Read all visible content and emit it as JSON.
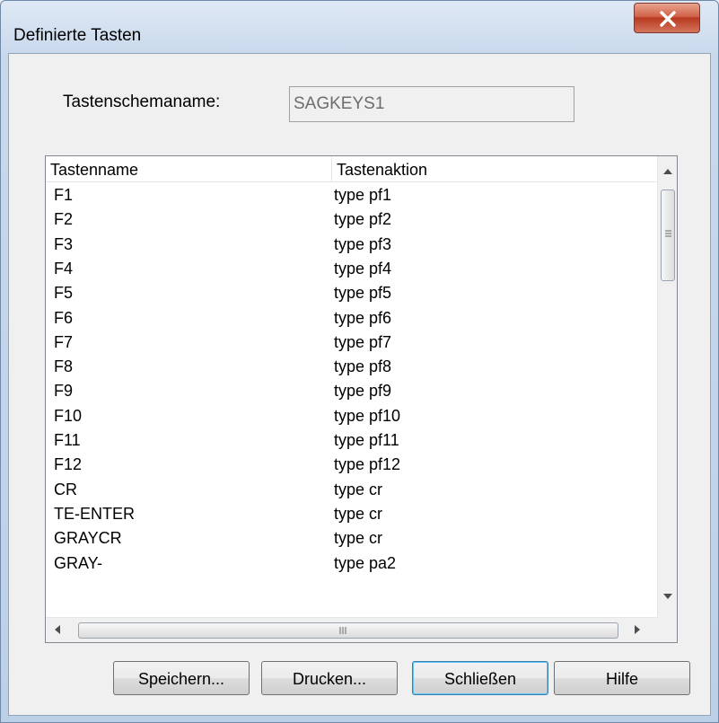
{
  "window": {
    "title": "Definierte Tasten",
    "close_icon": "close-x-icon"
  },
  "scheme": {
    "label": "Tastenschemaname:",
    "value": "SAGKEYS1"
  },
  "list": {
    "columns": [
      "Tastenname",
      "Tastenaktion"
    ],
    "rows": [
      {
        "key": "F1",
        "action": "type pf1"
      },
      {
        "key": "F2",
        "action": "type pf2"
      },
      {
        "key": "F3",
        "action": "type pf3"
      },
      {
        "key": "F4",
        "action": "type pf4"
      },
      {
        "key": "F5",
        "action": "type pf5"
      },
      {
        "key": "F6",
        "action": "type pf6"
      },
      {
        "key": "F7",
        "action": "type pf7"
      },
      {
        "key": "F8",
        "action": "type pf8"
      },
      {
        "key": "F9",
        "action": "type pf9"
      },
      {
        "key": "F10",
        "action": "type pf10"
      },
      {
        "key": "F11",
        "action": "type pf11"
      },
      {
        "key": "F12",
        "action": "type pf12"
      },
      {
        "key": "CR",
        "action": "type cr"
      },
      {
        "key": "TE-ENTER",
        "action": "type cr"
      },
      {
        "key": "GRAYCR",
        "action": "type cr"
      },
      {
        "key": "GRAY-",
        "action": "type pa2"
      }
    ]
  },
  "buttons": {
    "save": "Speichern...",
    "print": "Drucken...",
    "close": "Schließen",
    "help": "Hilfe"
  }
}
